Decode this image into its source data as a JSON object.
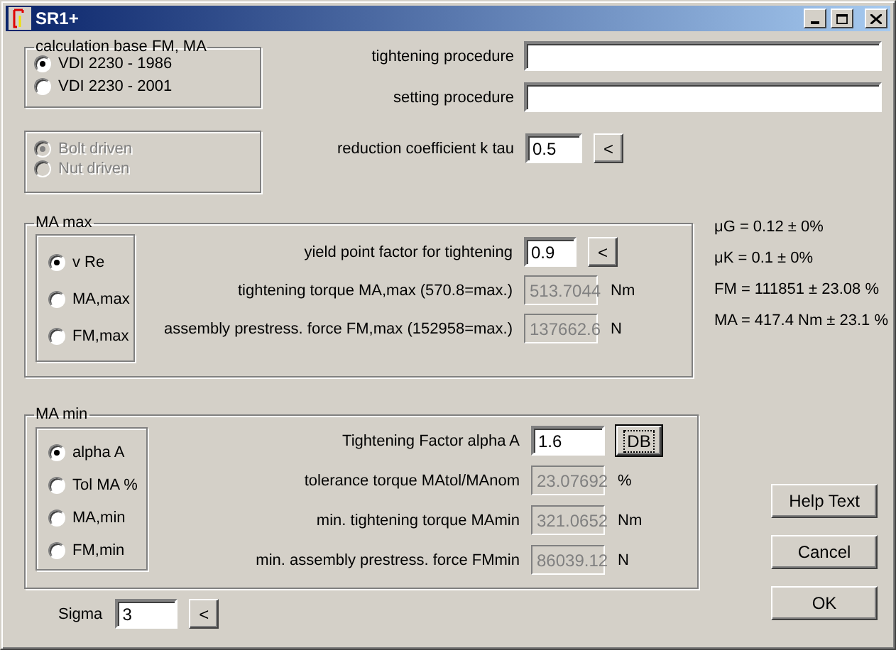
{
  "window": {
    "title": "SR1+"
  },
  "calculation_base": {
    "legend": "calculation base FM, MA",
    "options": [
      {
        "label": "VDI 2230 - 1986",
        "selected": true
      },
      {
        "label": "VDI 2230 - 2001",
        "selected": false
      }
    ]
  },
  "drive": {
    "disabled": true,
    "options": [
      {
        "label": "Bolt driven",
        "selected": true
      },
      {
        "label": "Nut driven",
        "selected": false
      }
    ]
  },
  "procedure_fields": [
    {
      "label": "tightening procedure"
    },
    {
      "label": "setting procedure"
    }
  ],
  "reduction": {
    "label": "reduction coefficient k tau",
    "value": "0.5",
    "disabled": false,
    "button": {
      "label": "<",
      "focused": false
    }
  },
  "ma_max": {
    "legend": "MA max",
    "options": [
      {
        "label": "v Re",
        "selected": true
      },
      {
        "label": "MA,max",
        "selected": false
      },
      {
        "label": "FM,max",
        "selected": false
      }
    ],
    "fields": [
      {
        "label": "yield point factor for tightening",
        "value": "0.9",
        "disabled": false,
        "button": {
          "label": "<",
          "focused": false
        }
      },
      {
        "label": "tightening torque MA,max (570.8=max.)",
        "value": "513.7044",
        "disabled": true,
        "unit": "Nm"
      },
      {
        "label": "assembly prestress. force FM,max (152958=max.)",
        "value": "137662.6",
        "disabled": true,
        "unit": "N"
      }
    ]
  },
  "results": [
    "μG = 0.12 ± 0%",
    "μK = 0.1 ± 0%",
    "FM = 111851 ± 23.08 %",
    "MA = 417.4 Nm ± 23.1 %"
  ],
  "ma_min": {
    "legend": "MA min",
    "options": [
      {
        "label": "alpha A",
        "selected": true
      },
      {
        "label": "Tol MA %",
        "selected": false
      },
      {
        "label": "MA,min",
        "selected": false
      },
      {
        "label": "FM,min",
        "selected": false
      }
    ],
    "fields": [
      {
        "label": "Tightening Factor alpha A",
        "value": "1.6",
        "disabled": false,
        "button": {
          "label": "DB",
          "focused": true
        }
      },
      {
        "label": "tolerance torque  MAtol/MAnom",
        "value": "23.07692",
        "disabled": true,
        "unit": "%"
      },
      {
        "label": "min. tightening torque MAmin",
        "value": "321.0652",
        "disabled": true,
        "unit": "Nm"
      },
      {
        "label": "min. assembly prestress. force FMmin",
        "value": "86039.12",
        "disabled": true,
        "unit": "N"
      }
    ]
  },
  "sigma": {
    "label": "Sigma",
    "value": "3",
    "disabled": false,
    "button": {
      "label": "<",
      "focused": false
    }
  },
  "buttons": [
    {
      "label": "Help Text"
    },
    {
      "label": "Cancel"
    },
    {
      "label": "OK"
    }
  ]
}
